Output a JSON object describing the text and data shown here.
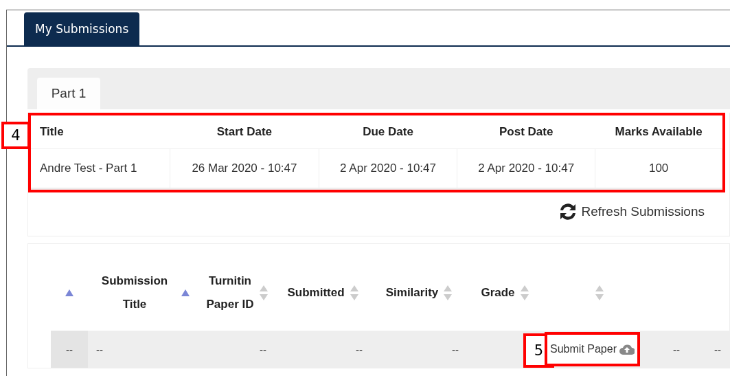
{
  "main_tab": {
    "label": "My Submissions",
    "selected": true
  },
  "part_tabs": [
    {
      "label": "Part 1",
      "selected": true
    }
  ],
  "assignment_table": {
    "callout": "4",
    "columns": [
      "Title",
      "Start Date",
      "Due Date",
      "Post Date",
      "Marks Available"
    ],
    "rows": [
      [
        "Andre Test - Part 1",
        "26 Mar 2020 - 10:47",
        "2 Apr 2020 - 10:47",
        "2 Apr 2020 - 10:47",
        "100"
      ]
    ]
  },
  "refresh_button": {
    "label": "Refresh Submissions"
  },
  "submissions_table": {
    "columns": [
      {
        "sortable": true,
        "sorted_ascending": true
      },
      {
        "label": "Submission Title",
        "sortable": true,
        "sorted_ascending": true
      },
      {
        "label": "Turnitin Paper ID",
        "sortable": true,
        "sorted_ascending": false
      },
      {
        "label": "Submitted",
        "sortable": true,
        "sorted_ascending": false
      },
      {
        "label": "Similarity",
        "sortable": true,
        "sorted_ascending": false
      },
      {
        "label": "Grade",
        "sortable": true,
        "sorted_ascending": false
      },
      {
        "sortable": true,
        "sorted_ascending": false
      },
      {},
      {}
    ],
    "rows": [
      [
        {
          "kind": "text",
          "text": "--"
        },
        {
          "kind": "text",
          "text": "--"
        },
        {
          "kind": "text",
          "text": "--"
        },
        {
          "kind": "text",
          "text": "--"
        },
        {
          "kind": "text",
          "text": "--"
        },
        {
          "kind": "empty"
        },
        {
          "kind": "button",
          "text": "Submit Paper",
          "callout": "5"
        },
        {
          "kind": "text",
          "text": "--"
        },
        {
          "kind": "text",
          "text": "--"
        }
      ]
    ]
  }
}
